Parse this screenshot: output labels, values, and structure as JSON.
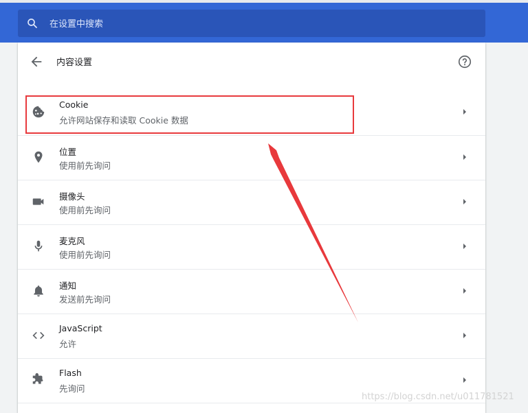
{
  "search": {
    "placeholder": "在设置中搜索"
  },
  "header": {
    "title": "内容设置"
  },
  "items": [
    {
      "title": "Cookie",
      "subtitle": "允许网站保存和读取 Cookie 数据",
      "icon": "cookie-icon"
    },
    {
      "title": "位置",
      "subtitle": "使用前先询问",
      "icon": "location-pin-icon"
    },
    {
      "title": "摄像头",
      "subtitle": "使用前先询问",
      "icon": "camera-icon"
    },
    {
      "title": "麦克风",
      "subtitle": "使用前先询问",
      "icon": "microphone-icon"
    },
    {
      "title": "通知",
      "subtitle": "发送前先询问",
      "icon": "bell-icon"
    },
    {
      "title": "JavaScript",
      "subtitle": "允许",
      "icon": "code-icon"
    },
    {
      "title": "Flash",
      "subtitle": "先询问",
      "icon": "puzzle-icon"
    }
  ],
  "colors": {
    "topbar": "#3367d6",
    "search_bg": "#2a55b8",
    "annotation": "#e8393c"
  },
  "watermark": "https://blog.csdn.net/u011781521"
}
